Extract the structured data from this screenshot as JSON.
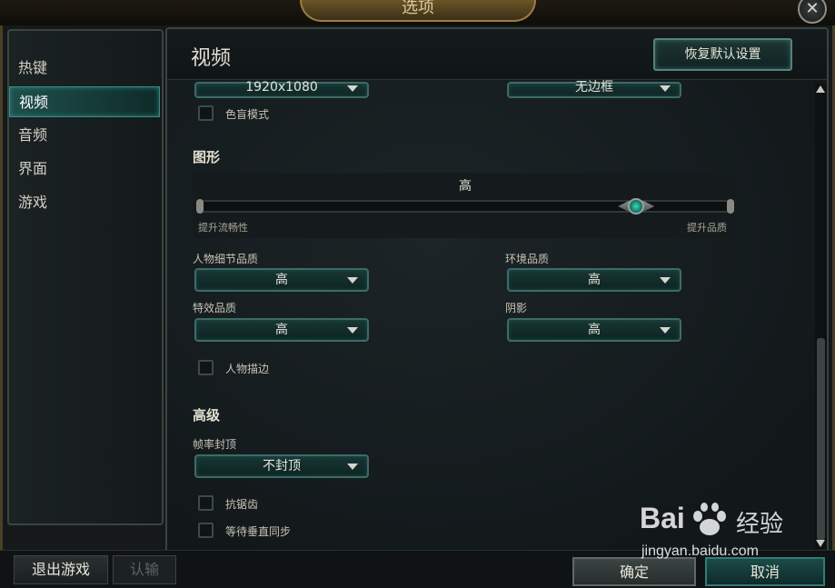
{
  "window": {
    "title": "选项",
    "close_symbol": "✕"
  },
  "sidebar": {
    "items": [
      {
        "label": "热键"
      },
      {
        "label": "视频"
      },
      {
        "label": "音频"
      },
      {
        "label": "界面"
      },
      {
        "label": "游戏"
      }
    ],
    "active": "视频"
  },
  "bottom": {
    "quit_label": "退出游戏",
    "report_label": "认输",
    "ok_label": "确定",
    "cancel_label": "取消"
  },
  "panel": {
    "title": "视频",
    "restore_label": "恢复默认设置",
    "top": {
      "resolution_value": "1920x1080",
      "window_mode_value": "无边框",
      "colorblind_label": "色盲模式"
    },
    "graphics": {
      "title": "图形",
      "slider_value_label": "高",
      "slider_position": 0.82,
      "min_label": "提升流畅性",
      "max_label": "提升品质",
      "character_quality_label": "人物细节品质",
      "character_quality_value": "高",
      "environment_quality_label": "环境品质",
      "environment_quality_value": "高",
      "effects_quality_label": "特效品质",
      "effects_quality_value": "高",
      "shadows_label": "阴影",
      "shadows_value": "高",
      "character_outline_label": "人物描边"
    },
    "advanced": {
      "title": "高级",
      "framerate_label": "帧率封顶",
      "framerate_value": "不封顶",
      "antialiasing_label": "抗锯齿",
      "vsync_label": "等待垂直同步"
    }
  },
  "watermark": {
    "logo_text": "Bai",
    "brand_text": "经验",
    "url": "jingyan.baidu.com"
  },
  "colors": {
    "accent_teal": "#3c8b85",
    "gold": "#9a7d42",
    "gem": "#3bd9b8"
  }
}
